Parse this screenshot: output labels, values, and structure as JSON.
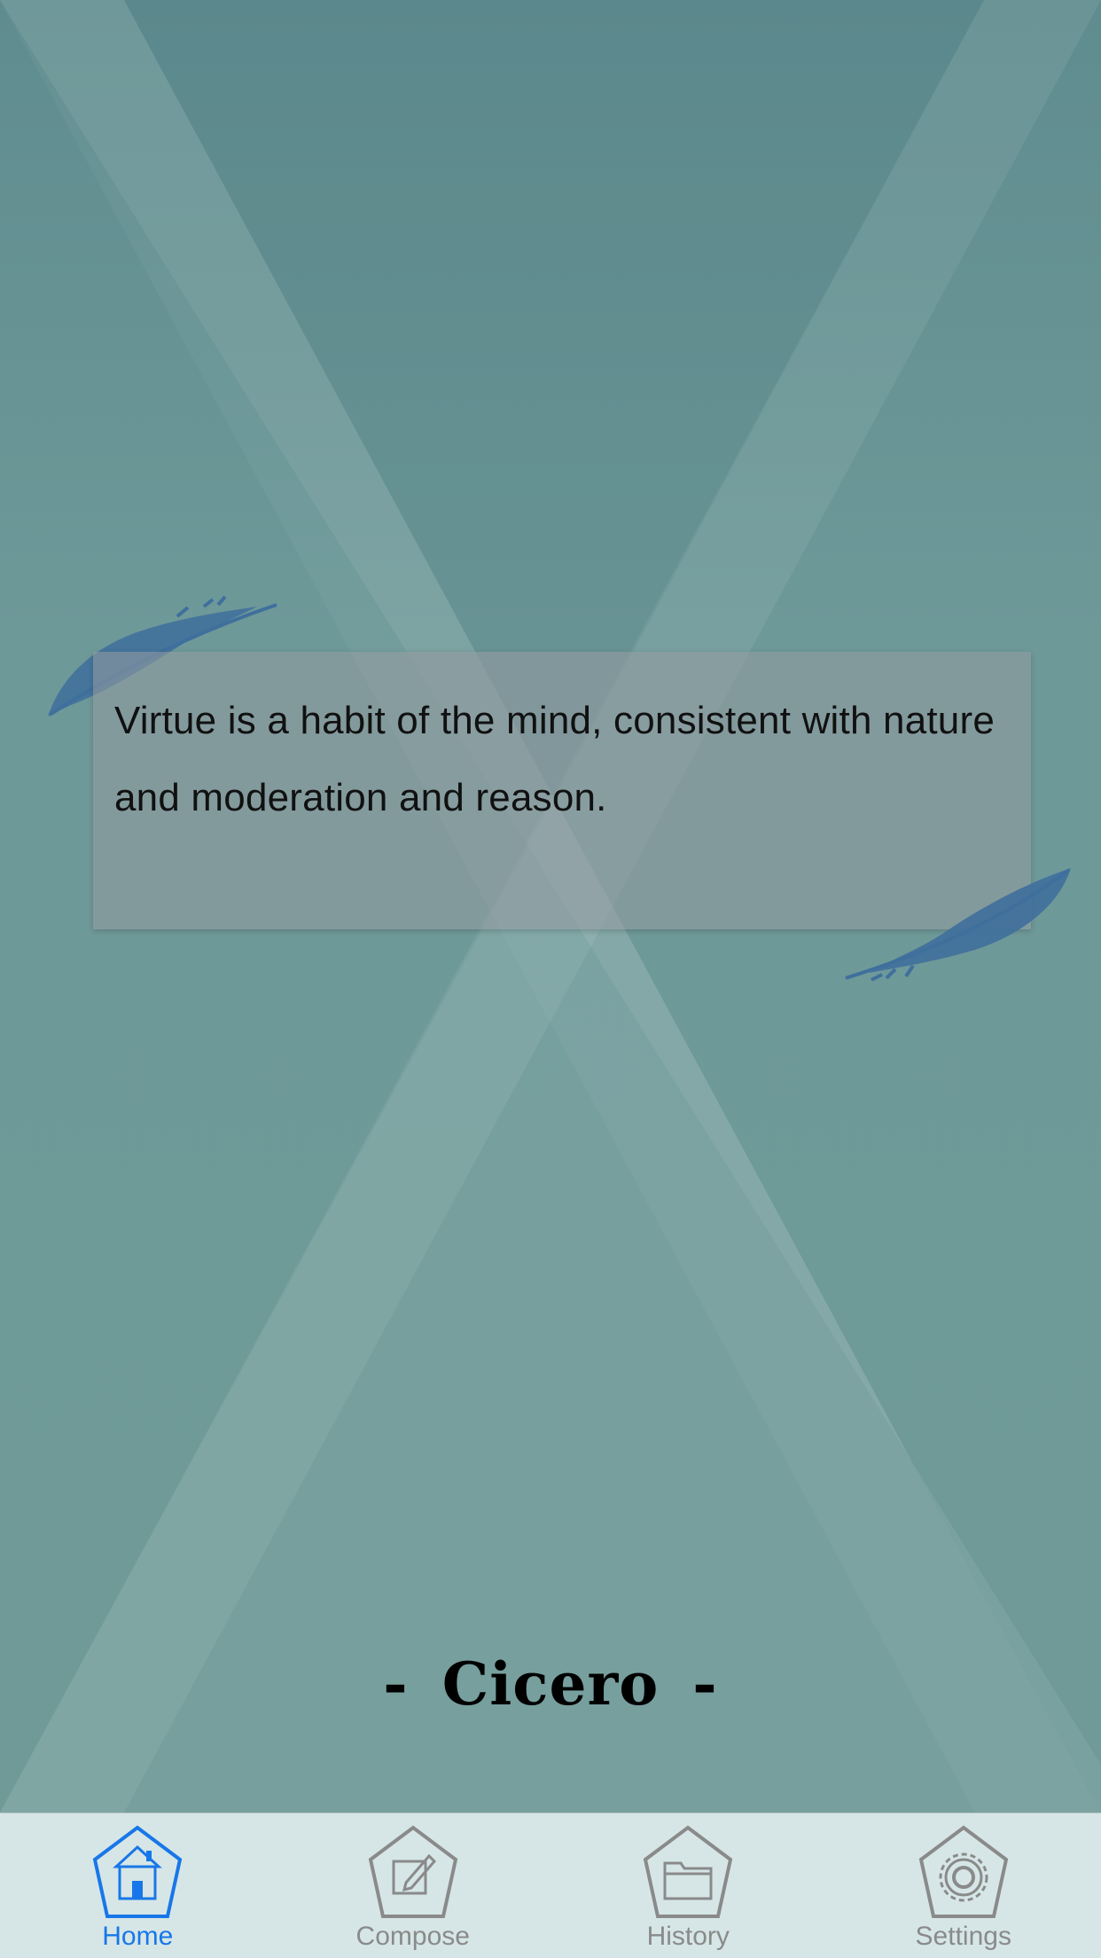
{
  "quote": {
    "text": "Virtue is a habit of the mind, consistent with nature and moderation and reason.",
    "author": "Cicero",
    "author_prefix": "-",
    "author_suffix": "-"
  },
  "tabbar": {
    "active": "home",
    "tabs": [
      {
        "id": "home",
        "label": "Home",
        "icon": "home-icon"
      },
      {
        "id": "compose",
        "label": "Compose",
        "icon": "compose-icon"
      },
      {
        "id": "history",
        "label": "History",
        "icon": "folder-icon"
      },
      {
        "id": "settings",
        "label": "Settings",
        "icon": "gear-icon"
      }
    ]
  },
  "colors": {
    "background": "#6d9898",
    "feather": "#3f6f9c",
    "tab_active": "#1877e8",
    "tab_inactive": "#8a8a8a",
    "tabbar_bg": "#d6e6e6"
  }
}
